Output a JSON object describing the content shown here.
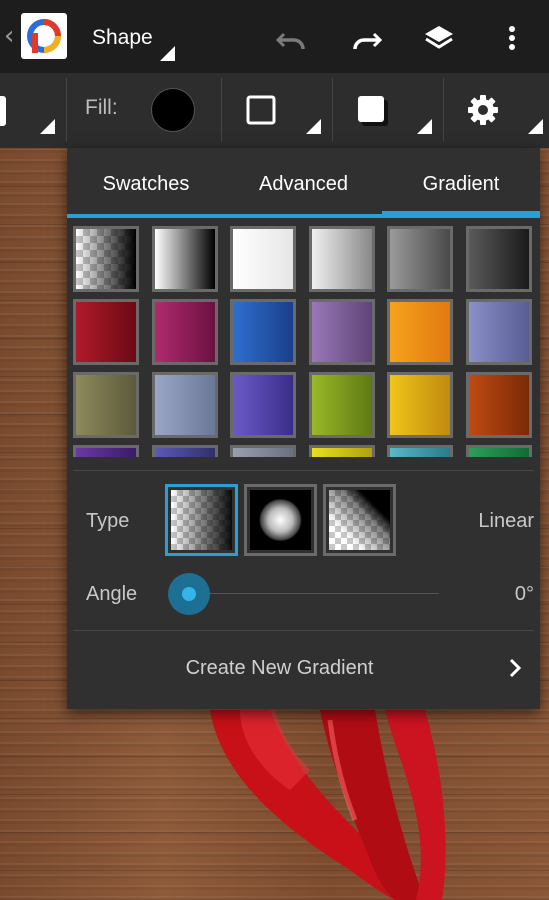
{
  "app": {
    "title": "Shape",
    "icons": [
      "back-chevron-icon",
      "photoshop-express-logo-icon",
      "undo-icon",
      "redo-icon",
      "layers-icon",
      "more-vertical-icon"
    ]
  },
  "toolbar": {
    "fill_label": "Fill:",
    "fill_color": "#000000",
    "icons": [
      "stroke-square-icon",
      "shadow-square-icon",
      "settings-gear-icon"
    ]
  },
  "panel": {
    "tabs": [
      {
        "label": "Swatches",
        "active": false
      },
      {
        "label": "Advanced",
        "active": false
      },
      {
        "label": "Gradient",
        "active": true
      }
    ],
    "accent_color": "#2a9fd6",
    "swatch_rows": [
      [
        {
          "from": "transparent",
          "to": "#000000"
        },
        {
          "from": "#ffffff",
          "to": "#000000"
        },
        {
          "from": "#ffffff",
          "to": "#e6e6e6"
        },
        {
          "from": "#f0f0f0",
          "to": "#888888"
        },
        {
          "from": "#9a9a9a",
          "to": "#4a4a4a"
        },
        {
          "from": "#5a5a5a",
          "to": "#1a1a1a"
        }
      ],
      [
        {
          "from": "#b01a2a",
          "to": "#6a0a14"
        },
        {
          "from": "#b02a6e",
          "to": "#6a1240"
        },
        {
          "from": "#2f6fd0",
          "to": "#1a3f8a"
        },
        {
          "from": "#9a78b8",
          "to": "#5e4478"
        },
        {
          "from": "#f7a21d",
          "to": "#e07a10"
        },
        {
          "from": "#8a90c8",
          "to": "#585e92"
        }
      ],
      [
        {
          "from": "#8d8a5c",
          "to": "#5c5a3a"
        },
        {
          "from": "#9aa6c4",
          "to": "#6a7898"
        },
        {
          "from": "#6a5ac8",
          "to": "#3a2e8a"
        },
        {
          "from": "#9ab82a",
          "to": "#5e7a12"
        },
        {
          "from": "#f0c51a",
          "to": "#c08a10"
        },
        {
          "from": "#c04a12",
          "to": "#7a2a08"
        }
      ],
      [
        {
          "from": "#6a3aa0",
          "to": "#3a1a6a"
        },
        {
          "from": "#5a5ab8",
          "to": "#30306a"
        },
        {
          "from": "#9aa0b0",
          "to": "#6a7080"
        },
        {
          "from": "#e8e020",
          "to": "#b0a010"
        },
        {
          "from": "#5ab8c8",
          "to": "#2a7a8a"
        },
        {
          "from": "#2aa05a",
          "to": "#146a34"
        }
      ]
    ],
    "type": {
      "label": "Type",
      "value": "Linear",
      "options": [
        "linear",
        "radial",
        "rectangular"
      ],
      "selected": "linear"
    },
    "angle": {
      "label": "Angle",
      "value": "0°",
      "fraction": 0.0
    },
    "create_label": "Create New Gradient"
  }
}
